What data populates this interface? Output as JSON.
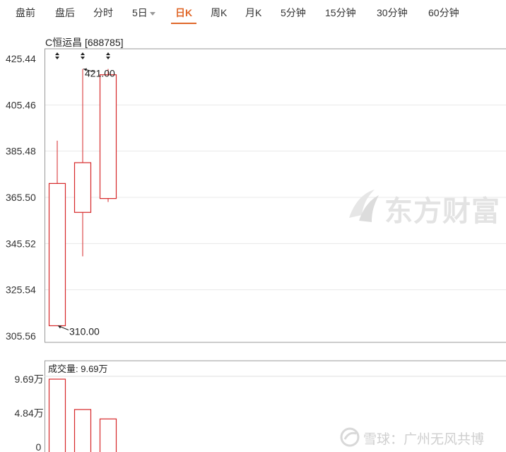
{
  "tabs": [
    {
      "label": "盘前"
    },
    {
      "label": "盘后"
    },
    {
      "label": "分时"
    },
    {
      "label": "5日"
    },
    {
      "label": "日K"
    },
    {
      "label": "周K"
    },
    {
      "label": "月K"
    },
    {
      "label": "5分钟"
    },
    {
      "label": "15分钟"
    },
    {
      "label": "30分钟"
    },
    {
      "label": "60分钟"
    }
  ],
  "active_tab": "日K",
  "stock_title": "C恒运昌 [688785]",
  "watermark": "东方财富",
  "bottom_watermark": "雪球：广州无风共博",
  "colors": {
    "up": "#d62728",
    "accent": "#e0682a",
    "grid": "#e8e8e8"
  },
  "chart_data": [
    {
      "type": "candlestick",
      "title": "C恒运昌 [688785]",
      "y_ticks": [
        "425.44",
        "405.46",
        "385.48",
        "365.50",
        "345.52",
        "325.54",
        "305.56"
      ],
      "ylim": [
        305.56,
        425.44
      ],
      "candles": [
        {
          "open": 310.0,
          "close": 371.5,
          "high": 390.0,
          "low": 310.0
        },
        {
          "open": 359.0,
          "close": 380.5,
          "high": 421.0,
          "low": 340.0
        },
        {
          "open": 365.0,
          "close": 418.5,
          "high": 421.0,
          "low": 363.5
        }
      ],
      "annotations": [
        {
          "text": "421.00",
          "candle": 1,
          "value": 421.0
        },
        {
          "text": "310.00",
          "candle": 0,
          "value": 310.0
        }
      ],
      "grid": true
    },
    {
      "type": "bar",
      "title": "成交量: 9.69万",
      "y_ticks": [
        "9.69万",
        "4.84万",
        "0"
      ],
      "ylim": [
        0,
        9.69
      ],
      "unit": "万",
      "values": [
        9.69,
        5.65,
        4.4
      ]
    }
  ]
}
